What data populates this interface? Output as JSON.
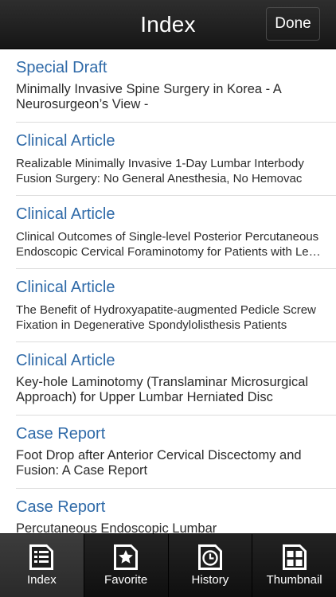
{
  "header": {
    "title": "Index",
    "done_label": "Done"
  },
  "articles": [
    {
      "category": "Special Draft",
      "title": "Minimally Invasive Spine Surgery in Korea - A Neurosurgeon’s View -"
    },
    {
      "category": "Clinical Article",
      "title": "Realizable Minimally Invasive 1-Day Lumbar Interbody Fusion Surgery: No General Anesthesia, No Hemovac"
    },
    {
      "category": "Clinical Article",
      "title": "Clinical Outcomes of Single-level Posterior Percutaneous Endoscopic Cervical Foraminotomy for Patients with Less Cervical Lordosis"
    },
    {
      "category": "Clinical Article",
      "title": "The Benefit of Hydroxyapatite-augmented Pedicle Screw Fixation in Degenerative Spondylolisthesis Patients"
    },
    {
      "category": "Clinical Article",
      "title": "Key-hole Laminotomy (Translaminar Microsurgical Approach) for Upper Lumbar Herniated Disc"
    },
    {
      "category": "Case Report",
      "title": "Foot Drop after Anterior Cervical Discectomy and Fusion: A Case Report"
    },
    {
      "category": "Case Report",
      "title": "Percutaneous Endoscopic Lumbar"
    }
  ],
  "tabs": [
    {
      "label": "Index",
      "icon": "index-list-icon",
      "active": true
    },
    {
      "label": "Favorite",
      "icon": "favorite-star-icon",
      "active": false
    },
    {
      "label": "History",
      "icon": "history-clock-icon",
      "active": false
    },
    {
      "label": "Thumbnail",
      "icon": "thumbnail-grid-icon",
      "active": false
    }
  ],
  "colors": {
    "category": "#2f6aa8",
    "bar": "#1a1a1a",
    "text": "#2b2b2b"
  }
}
